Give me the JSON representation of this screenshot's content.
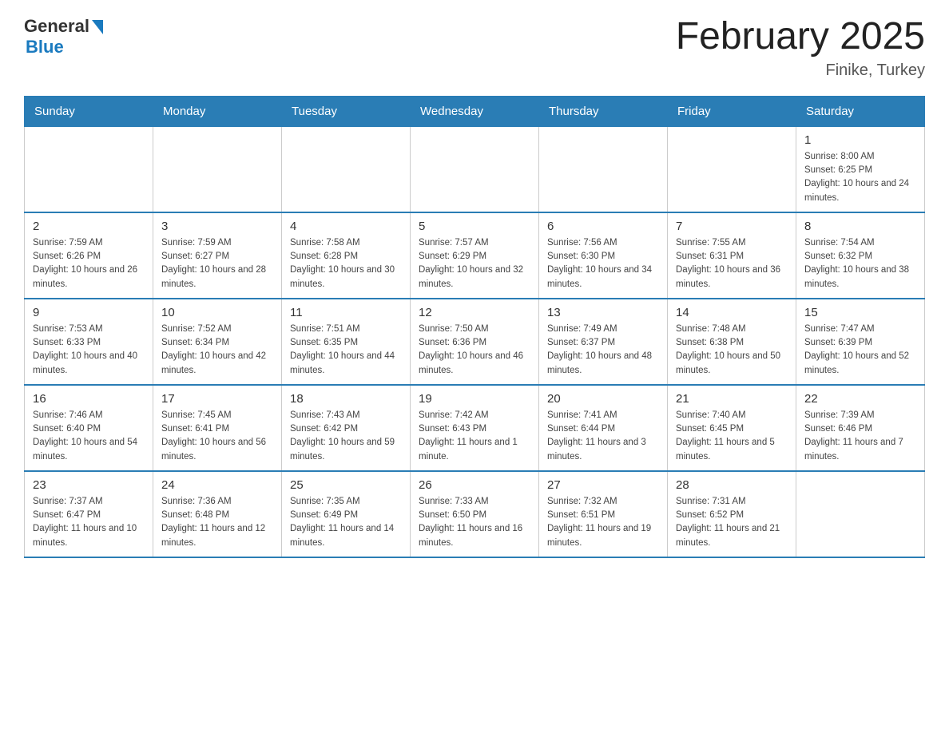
{
  "logo": {
    "general": "General",
    "blue": "Blue"
  },
  "title": "February 2025",
  "location": "Finike, Turkey",
  "days_of_week": [
    "Sunday",
    "Monday",
    "Tuesday",
    "Wednesday",
    "Thursday",
    "Friday",
    "Saturday"
  ],
  "weeks": [
    [
      {
        "day": "",
        "sunrise": "",
        "sunset": "",
        "daylight": ""
      },
      {
        "day": "",
        "sunrise": "",
        "sunset": "",
        "daylight": ""
      },
      {
        "day": "",
        "sunrise": "",
        "sunset": "",
        "daylight": ""
      },
      {
        "day": "",
        "sunrise": "",
        "sunset": "",
        "daylight": ""
      },
      {
        "day": "",
        "sunrise": "",
        "sunset": "",
        "daylight": ""
      },
      {
        "day": "",
        "sunrise": "",
        "sunset": "",
        "daylight": ""
      },
      {
        "day": "1",
        "sunrise": "Sunrise: 8:00 AM",
        "sunset": "Sunset: 6:25 PM",
        "daylight": "Daylight: 10 hours and 24 minutes."
      }
    ],
    [
      {
        "day": "2",
        "sunrise": "Sunrise: 7:59 AM",
        "sunset": "Sunset: 6:26 PM",
        "daylight": "Daylight: 10 hours and 26 minutes."
      },
      {
        "day": "3",
        "sunrise": "Sunrise: 7:59 AM",
        "sunset": "Sunset: 6:27 PM",
        "daylight": "Daylight: 10 hours and 28 minutes."
      },
      {
        "day": "4",
        "sunrise": "Sunrise: 7:58 AM",
        "sunset": "Sunset: 6:28 PM",
        "daylight": "Daylight: 10 hours and 30 minutes."
      },
      {
        "day": "5",
        "sunrise": "Sunrise: 7:57 AM",
        "sunset": "Sunset: 6:29 PM",
        "daylight": "Daylight: 10 hours and 32 minutes."
      },
      {
        "day": "6",
        "sunrise": "Sunrise: 7:56 AM",
        "sunset": "Sunset: 6:30 PM",
        "daylight": "Daylight: 10 hours and 34 minutes."
      },
      {
        "day": "7",
        "sunrise": "Sunrise: 7:55 AM",
        "sunset": "Sunset: 6:31 PM",
        "daylight": "Daylight: 10 hours and 36 minutes."
      },
      {
        "day": "8",
        "sunrise": "Sunrise: 7:54 AM",
        "sunset": "Sunset: 6:32 PM",
        "daylight": "Daylight: 10 hours and 38 minutes."
      }
    ],
    [
      {
        "day": "9",
        "sunrise": "Sunrise: 7:53 AM",
        "sunset": "Sunset: 6:33 PM",
        "daylight": "Daylight: 10 hours and 40 minutes."
      },
      {
        "day": "10",
        "sunrise": "Sunrise: 7:52 AM",
        "sunset": "Sunset: 6:34 PM",
        "daylight": "Daylight: 10 hours and 42 minutes."
      },
      {
        "day": "11",
        "sunrise": "Sunrise: 7:51 AM",
        "sunset": "Sunset: 6:35 PM",
        "daylight": "Daylight: 10 hours and 44 minutes."
      },
      {
        "day": "12",
        "sunrise": "Sunrise: 7:50 AM",
        "sunset": "Sunset: 6:36 PM",
        "daylight": "Daylight: 10 hours and 46 minutes."
      },
      {
        "day": "13",
        "sunrise": "Sunrise: 7:49 AM",
        "sunset": "Sunset: 6:37 PM",
        "daylight": "Daylight: 10 hours and 48 minutes."
      },
      {
        "day": "14",
        "sunrise": "Sunrise: 7:48 AM",
        "sunset": "Sunset: 6:38 PM",
        "daylight": "Daylight: 10 hours and 50 minutes."
      },
      {
        "day": "15",
        "sunrise": "Sunrise: 7:47 AM",
        "sunset": "Sunset: 6:39 PM",
        "daylight": "Daylight: 10 hours and 52 minutes."
      }
    ],
    [
      {
        "day": "16",
        "sunrise": "Sunrise: 7:46 AM",
        "sunset": "Sunset: 6:40 PM",
        "daylight": "Daylight: 10 hours and 54 minutes."
      },
      {
        "day": "17",
        "sunrise": "Sunrise: 7:45 AM",
        "sunset": "Sunset: 6:41 PM",
        "daylight": "Daylight: 10 hours and 56 minutes."
      },
      {
        "day": "18",
        "sunrise": "Sunrise: 7:43 AM",
        "sunset": "Sunset: 6:42 PM",
        "daylight": "Daylight: 10 hours and 59 minutes."
      },
      {
        "day": "19",
        "sunrise": "Sunrise: 7:42 AM",
        "sunset": "Sunset: 6:43 PM",
        "daylight": "Daylight: 11 hours and 1 minute."
      },
      {
        "day": "20",
        "sunrise": "Sunrise: 7:41 AM",
        "sunset": "Sunset: 6:44 PM",
        "daylight": "Daylight: 11 hours and 3 minutes."
      },
      {
        "day": "21",
        "sunrise": "Sunrise: 7:40 AM",
        "sunset": "Sunset: 6:45 PM",
        "daylight": "Daylight: 11 hours and 5 minutes."
      },
      {
        "day": "22",
        "sunrise": "Sunrise: 7:39 AM",
        "sunset": "Sunset: 6:46 PM",
        "daylight": "Daylight: 11 hours and 7 minutes."
      }
    ],
    [
      {
        "day": "23",
        "sunrise": "Sunrise: 7:37 AM",
        "sunset": "Sunset: 6:47 PM",
        "daylight": "Daylight: 11 hours and 10 minutes."
      },
      {
        "day": "24",
        "sunrise": "Sunrise: 7:36 AM",
        "sunset": "Sunset: 6:48 PM",
        "daylight": "Daylight: 11 hours and 12 minutes."
      },
      {
        "day": "25",
        "sunrise": "Sunrise: 7:35 AM",
        "sunset": "Sunset: 6:49 PM",
        "daylight": "Daylight: 11 hours and 14 minutes."
      },
      {
        "day": "26",
        "sunrise": "Sunrise: 7:33 AM",
        "sunset": "Sunset: 6:50 PM",
        "daylight": "Daylight: 11 hours and 16 minutes."
      },
      {
        "day": "27",
        "sunrise": "Sunrise: 7:32 AM",
        "sunset": "Sunset: 6:51 PM",
        "daylight": "Daylight: 11 hours and 19 minutes."
      },
      {
        "day": "28",
        "sunrise": "Sunrise: 7:31 AM",
        "sunset": "Sunset: 6:52 PM",
        "daylight": "Daylight: 11 hours and 21 minutes."
      },
      {
        "day": "",
        "sunrise": "",
        "sunset": "",
        "daylight": ""
      }
    ]
  ]
}
